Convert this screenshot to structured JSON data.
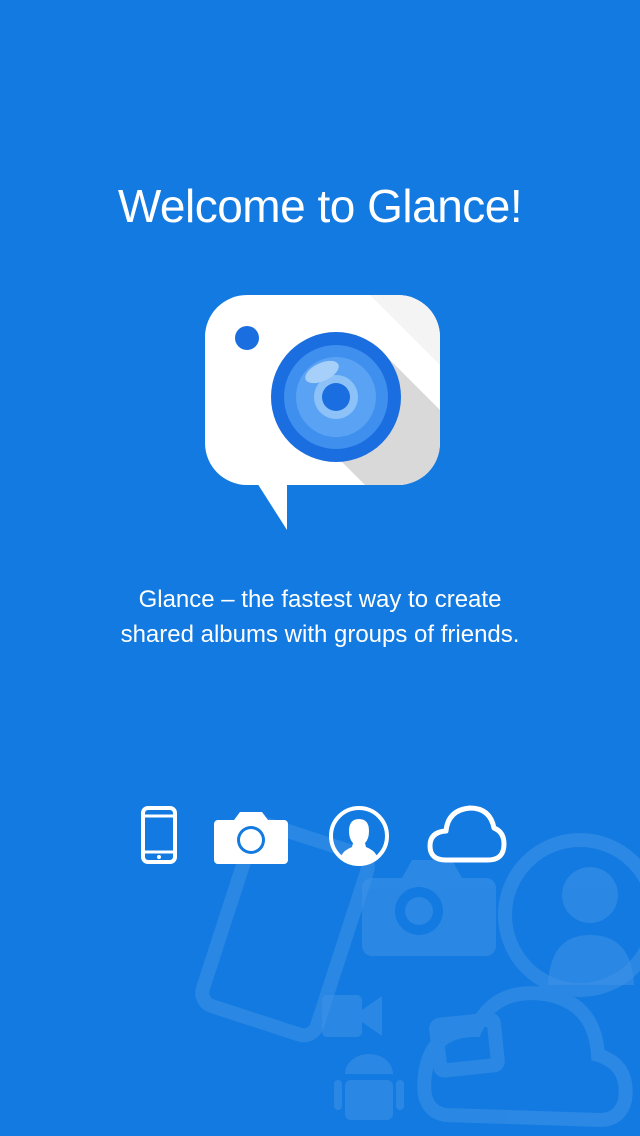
{
  "welcome": {
    "title": "Welcome to Glance!",
    "tagline_line1": "Glance – the fastest way to create",
    "tagline_line2": "shared albums with groups of friends."
  },
  "logo": {
    "icon": "camera-chat-bubble-icon"
  },
  "features": [
    {
      "icon": "phone-icon"
    },
    {
      "icon": "camera-icon"
    },
    {
      "icon": "person-icon"
    },
    {
      "icon": "cloud-icon"
    }
  ],
  "colors": {
    "background": "#127ae0",
    "lens_outer": "#1a6ee0",
    "lens_inner": "#4a99f0",
    "bubble": "#ffffff",
    "shadow": "#d8d8d8"
  }
}
